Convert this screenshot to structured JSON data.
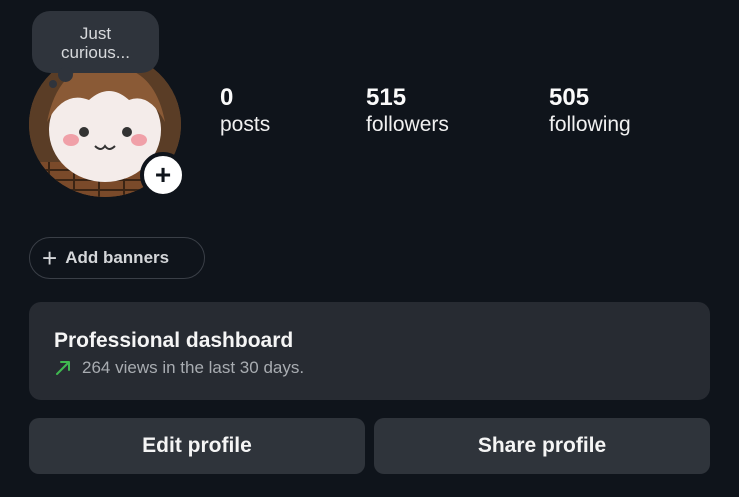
{
  "note": {
    "text": "Just curious..."
  },
  "stats": [
    {
      "value": "0",
      "label": "posts"
    },
    {
      "value": "515",
      "label": "followers"
    },
    {
      "value": "505",
      "label": "following"
    }
  ],
  "add_banners": {
    "label": "Add banners"
  },
  "dashboard": {
    "title": "Professional dashboard",
    "subtitle": "264 views in the last 30 days.",
    "trend_color": "#3fb950"
  },
  "buttons": {
    "edit": "Edit profile",
    "share": "Share profile"
  },
  "icons": {
    "add_story": "plus-icon",
    "add_banners": "plus-icon",
    "trend": "trend-up-arrow-icon"
  }
}
